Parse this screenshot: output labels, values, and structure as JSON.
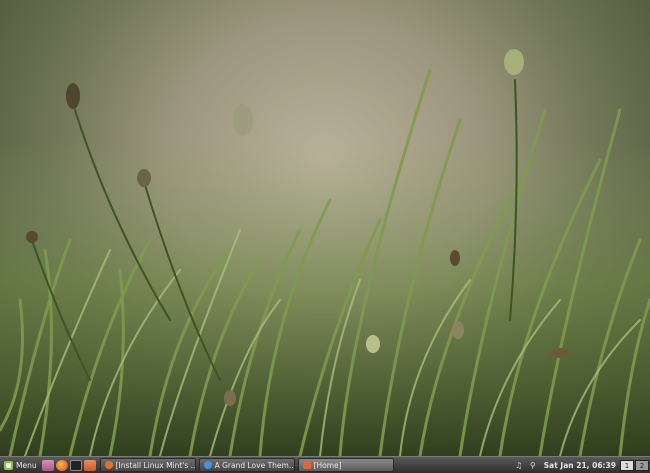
{
  "panel": {
    "menu_label": "Menu",
    "tasks": [
      {
        "label": "[Install Linux Mint's ...",
        "icon": "firefox-icon",
        "color": "#e8702a"
      },
      {
        "label": "A Grand Love Them...",
        "icon": "chrome-icon",
        "color": "#4a8fe0"
      },
      {
        "label": "[Home]",
        "icon": "folder-icon",
        "color": "#d9683a"
      }
    ],
    "clock": "Sat Jan 21, 06:39",
    "workspaces": [
      "1",
      "2"
    ],
    "music_icon": "♫",
    "network_icon": "⚲"
  },
  "colors": {
    "panel": "#3a3a3a",
    "grass": "#5f7a3c",
    "background": "#a8a38a"
  }
}
